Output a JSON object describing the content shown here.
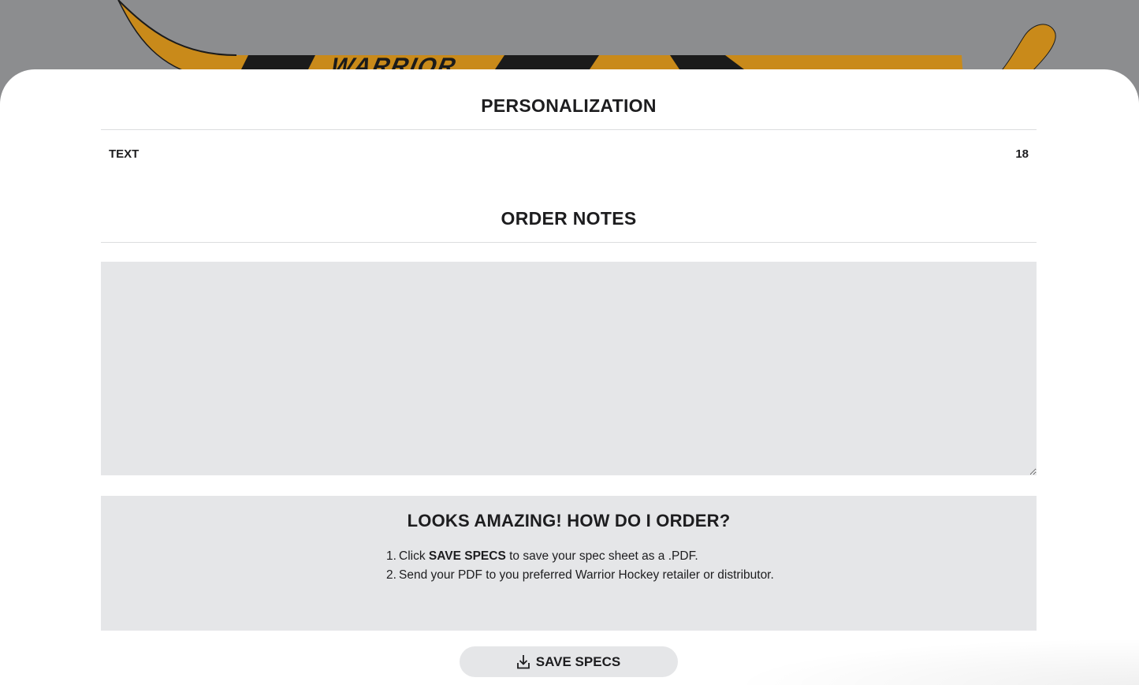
{
  "banner": {
    "brand_text": "WARRIOR",
    "colors": {
      "background": "#8c8d8f",
      "stick": "#c98a1a",
      "stick_dark": "#1b1b1b"
    }
  },
  "personalization": {
    "title": "PERSONALIZATION",
    "rows": [
      {
        "label": "TEXT",
        "value": "18"
      }
    ]
  },
  "order_notes": {
    "title": "ORDER NOTES",
    "value": "",
    "placeholder": ""
  },
  "how_to_order": {
    "title": "LOOKS AMAZING! HOW DO I ORDER?",
    "steps": [
      {
        "num": "1.",
        "pre": "Click ",
        "bold": "SAVE SPECS",
        "post": " to save your spec sheet as a .PDF."
      },
      {
        "num": "2.",
        "pre": "Send your PDF to you preferred Warrior Hockey retailer or distributor.",
        "bold": "",
        "post": ""
      }
    ]
  },
  "actions": {
    "save_label": "SAVE SPECS",
    "save_icon": "download-icon"
  },
  "colors": {
    "panel": "#ffffff",
    "field_bg": "#e5e6e8",
    "text": "#1d1d1f",
    "divider": "#dcdddf"
  }
}
